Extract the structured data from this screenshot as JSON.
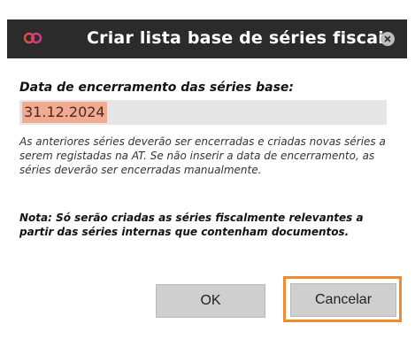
{
  "dialog": {
    "title": "Criar lista base de séries fiscais",
    "icon": "app-logo-icon",
    "close_icon": "close-icon"
  },
  "form": {
    "date_label": "Data de encerramento das séries base:",
    "date_value": "31.12.2024",
    "info": "As anteriores séries deverão ser encerradas e criadas novas séries a serem registadas na AT. Se não inserir a data de encerramento, as séries deverão ser encerradas manualmente.",
    "note": "Nota: Só serão criadas as séries fiscalmente relevantes a partir das séries internas que contenham documentos."
  },
  "buttons": {
    "ok_label": "OK",
    "cancel_label": "Cancelar"
  },
  "colors": {
    "titlebar": "#2b2b2b",
    "highlight": "#f08a2c",
    "date_selection": "#f2ab90",
    "logo": "#e84b3c"
  }
}
